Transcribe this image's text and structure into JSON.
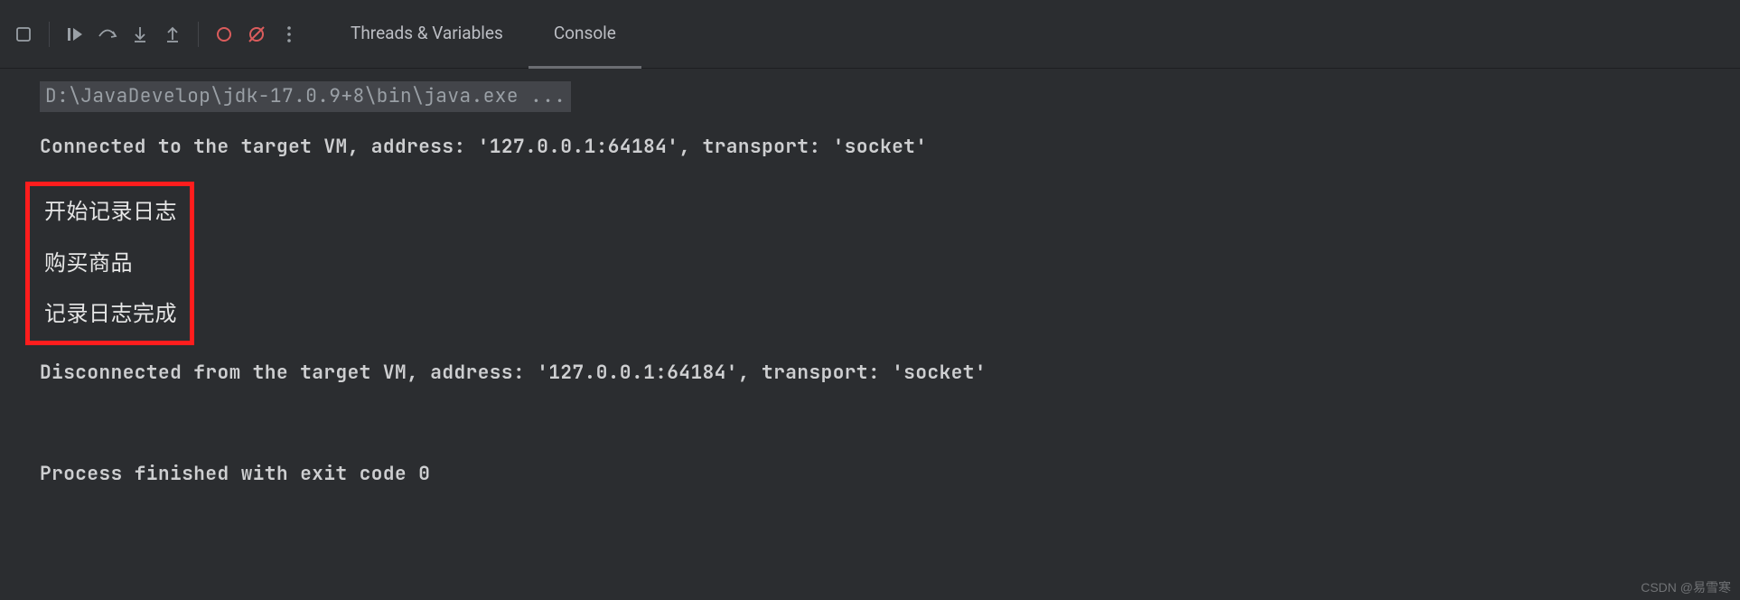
{
  "toolbar": {
    "tabs": {
      "threads": "Threads & Variables",
      "console": "Console"
    }
  },
  "console": {
    "cmd": "D:\\JavaDevelop\\jdk-17.0.9+8\\bin\\java.exe ...",
    "connected": "Connected to the target VM, address: '127.0.0.1:64184', transport: 'socket'",
    "out1": "开始记录日志",
    "out2": "购买商品",
    "out3": "记录日志完成",
    "disconnected": "Disconnected from the target VM, address: '127.0.0.1:64184', transport: 'socket'",
    "process": "Process finished with exit code 0"
  },
  "watermark": "CSDN @易雪寒"
}
